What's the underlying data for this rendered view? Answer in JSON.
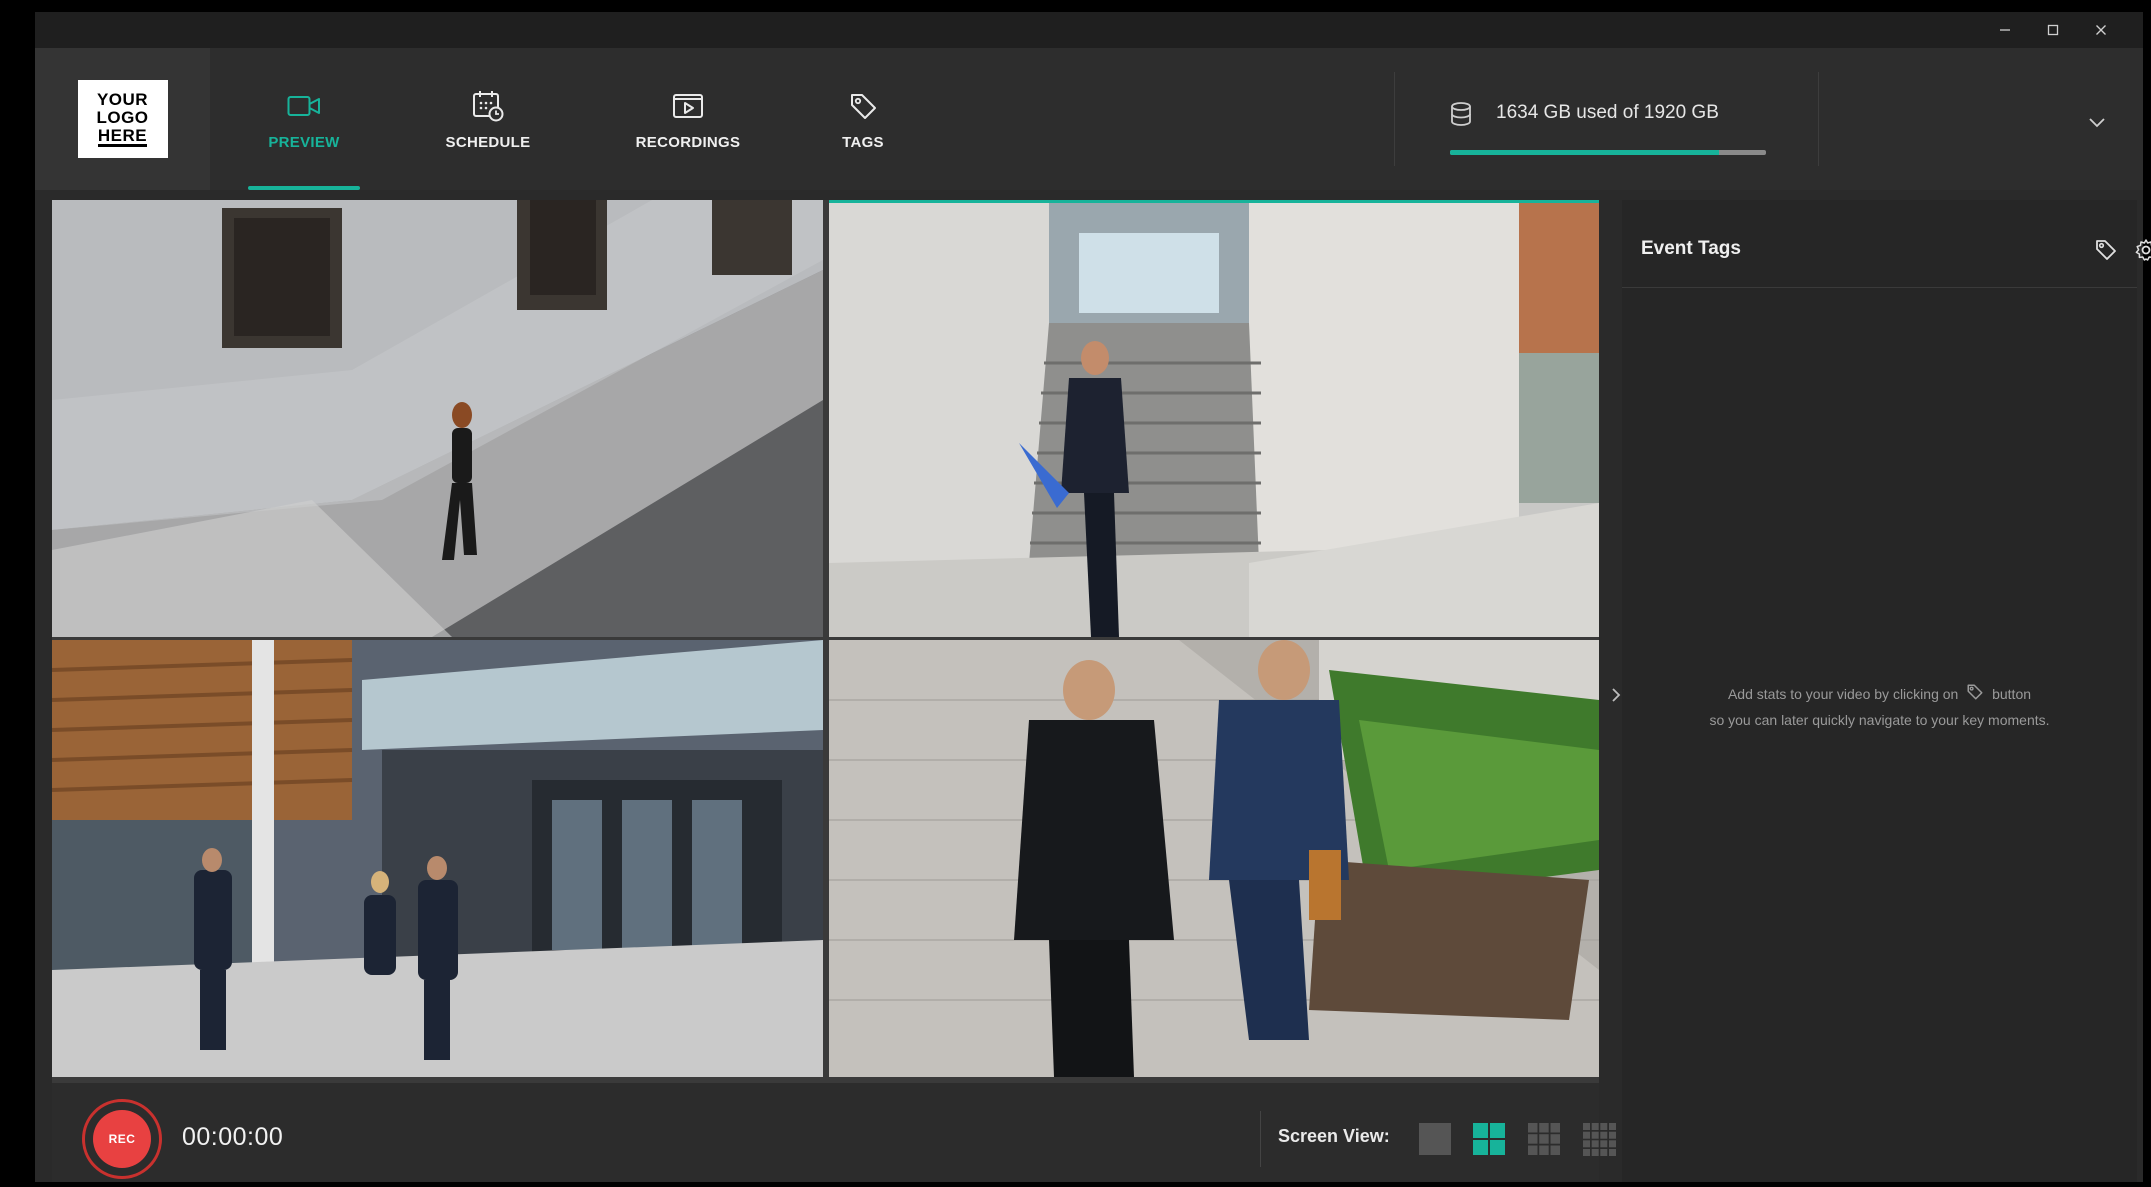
{
  "window": {
    "controls": {
      "minimize": "minimize-icon",
      "maximize": "maximize-icon",
      "close": "close-icon"
    }
  },
  "logo": {
    "line1": "YOUR",
    "line2": "LOGO",
    "line3": "HERE"
  },
  "nav": {
    "tabs": [
      {
        "label": "PREVIEW",
        "icon": "video-camera-icon",
        "active": true
      },
      {
        "label": "SCHEDULE",
        "icon": "calendar-clock-icon",
        "active": false
      },
      {
        "label": "RECORDINGS",
        "icon": "play-screen-icon",
        "active": false
      },
      {
        "label": "TAGS",
        "icon": "tag-icon",
        "active": false
      }
    ]
  },
  "storage": {
    "text": "1634 GB used of 1920 GB",
    "used_gb": 1634,
    "total_gb": 1920,
    "icon": "database-icon"
  },
  "recording": {
    "rec_label": "REC",
    "timer": "00:00:00"
  },
  "screen_view": {
    "label": "Screen View:",
    "options": [
      {
        "name": "single",
        "active": false
      },
      {
        "name": "grid-2x2",
        "active": true
      },
      {
        "name": "grid-3x3",
        "active": false
      },
      {
        "name": "grid-4x4",
        "active": false
      }
    ]
  },
  "event_tags": {
    "title": "Event Tags",
    "hint_before": "Add stats to your video by clicking on",
    "hint_after": "button",
    "hint_line2": "so you can later quickly navigate to your key moments."
  },
  "colors": {
    "accent": "#17b39a",
    "rec": "#e84141",
    "background": "#2a2a2a",
    "panel": "#262626"
  }
}
